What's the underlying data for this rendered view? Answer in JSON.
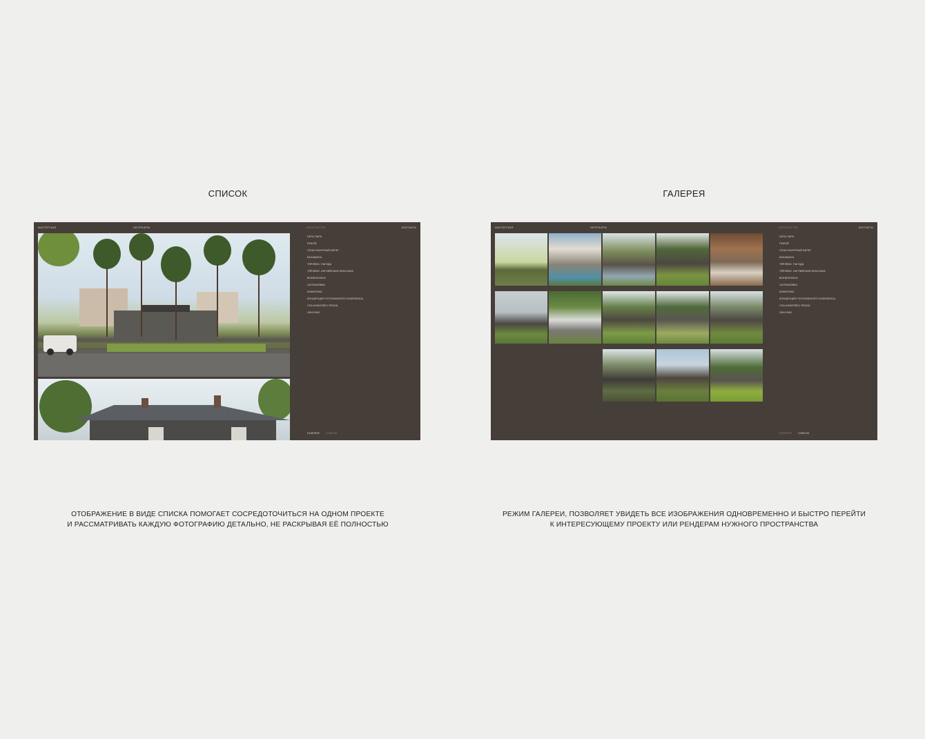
{
  "left": {
    "title": "СПИСОК",
    "mock": {
      "nav_left": "МАСТЕРСКАЯ",
      "nav_mid": "ИНТЕРЬЕРЫ",
      "nav_section": "АРХИТЕКТУРА",
      "nav_right": "КОНТАКТЫ",
      "projects": [
        "ОКТА ПАРК",
        "ПОКОЙ",
        "СОЧИ ЛАЗУРНЫЙ БЕРЕГ",
        "БАЛАШИХА",
        "ТЯРЛЕВО. ПАГОДА",
        "ТЯРЛЕВО. АНГЛИЙСКАЯ КЛАССИКА",
        "ВСЕВОЛОЖСК",
        "САЛТЫКОВКА",
        "КОМАРОВО",
        "КОНЦЕПЦИЯ ГОСТИНИЧНОГО КОМПЛЕКСА",
        "СПА КОМПЛЕКС ПЕСКИ",
        "ОЛЬГИНО"
      ],
      "toggle_gallery": "ГАЛЕРЕЯ",
      "toggle_list": "СПИСОК",
      "active_view": "gallery"
    },
    "caption_line1": "ОТОБРАЖЕНИЕ В ВИДЕ СПИСКА ПОМОГАЕТ СОСРЕДОТОЧИТЬСЯ НА ОДНОМ ПРОЕКТЕ",
    "caption_line2": "И РАССМАТРИВАТЬ КАЖДУЮ ФОТОГРАФИЮ ДЕТАЛЬНО, НЕ РАСКРЫВАЯ ЕЁ ПОЛНОСТЬЮ"
  },
  "right": {
    "title": "ГАЛЕРЕЯ",
    "mock": {
      "nav_left": "МАСТЕРСКАЯ",
      "nav_mid": "ИНТЕРЬЕРЫ",
      "nav_section": "АРХИТЕКТУРА",
      "nav_right": "КОНТАКТЫ",
      "projects": [
        "ОКТА ПАРК",
        "ПОКОЙ",
        "СОЧИ ЛАЗУРНЫЙ БЕРЕГ",
        "БАЛАШИХА",
        "ТЯРЛЕВО. ПАГОДА",
        "ТЯРЛЕВО. АНГЛИЙСКАЯ КЛАССИКА",
        "ВСЕВОЛОЖСК",
        "САЛТЫКОВКА",
        "КОМАРОВО",
        "КОНЦЕПЦИЯ ГОСТИНИЧНОГО КОМПЛЕКСА",
        "СПА КОМПЛЕКС ПЕСКИ",
        "ОЛЬГИНО"
      ],
      "toggle_gallery": "ГАЛЕРЕЯ",
      "toggle_list": "СПИСОК",
      "active_view": "list"
    },
    "caption_line1": "РЕЖИМ ГАЛЕРЕИ, ПОЗВОЛЯЕТ УВИДЕТЬ ВСЕ ИЗОБРАЖЕНИЯ ОДНОВРЕМЕННО И БЫСТРО ПЕРЕЙТИ",
    "caption_line2": "К ИНТЕРЕСУЮЩЕМУ ПРОЕКТУ ИЛИ РЕНДЕРАМ НУЖНОГО ПРОСТРАНСТВА"
  },
  "colors": {
    "page_bg": "#efefee",
    "mock_bg": "#463e39",
    "menu_text": "#e2dbd2",
    "menu_dim": "#8f857b"
  }
}
